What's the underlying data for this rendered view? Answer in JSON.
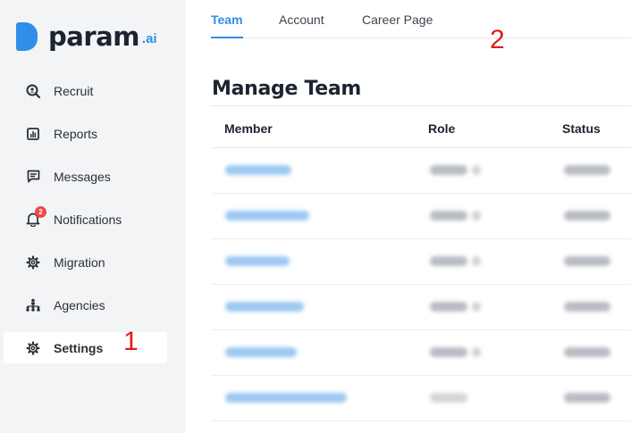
{
  "sidebar": {
    "logo_text": "param",
    "logo_suffix": ".ai",
    "items": [
      {
        "label": "Recruit",
        "icon": "search-icon"
      },
      {
        "label": "Reports",
        "icon": "chart-icon"
      },
      {
        "label": "Messages",
        "icon": "message-icon"
      },
      {
        "label": "Notifications",
        "icon": "bell-icon",
        "badge": "2"
      },
      {
        "label": "Migration",
        "icon": "gear-icon"
      },
      {
        "label": "Agencies",
        "icon": "org-chart-icon"
      },
      {
        "label": "Settings",
        "icon": "gear-icon",
        "active": true
      }
    ]
  },
  "annotations": {
    "marker_1": "1",
    "marker_2": "2"
  },
  "tabs": [
    {
      "label": "Team",
      "active": true
    },
    {
      "label": "Account"
    },
    {
      "label": "Career Page"
    }
  ],
  "page_title": "Manage Team",
  "table": {
    "columns": [
      "Member",
      "Role",
      "Status"
    ],
    "row_count": 6,
    "member_names_blurred": true
  },
  "colors": {
    "accent": "#2f8fe8",
    "sidebar_bg": "#f3f4f6",
    "badge": "#f0474b",
    "annotation": "#e31b1b"
  }
}
